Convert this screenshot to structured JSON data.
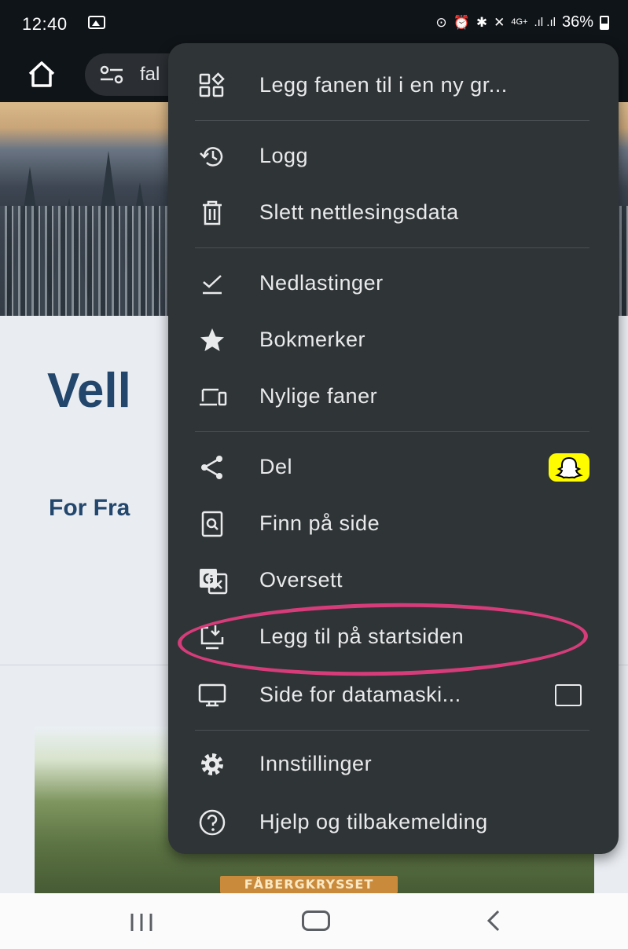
{
  "status_bar": {
    "time": "12:40",
    "network": "4G+",
    "signal": ".ıl .ıl",
    "battery": "36%"
  },
  "toolbar": {
    "url": "fal"
  },
  "page": {
    "title": "Vell",
    "subtitle": "For Fra",
    "photo_sign": "FÅBERGKRYSSET"
  },
  "menu": {
    "items": [
      {
        "label": "Legg fanen til i en ny gr...",
        "icon": "tab-group-icon"
      },
      {
        "label": "Logg",
        "icon": "history-icon"
      },
      {
        "label": "Slett nettlesingsdata",
        "icon": "trash-icon"
      },
      {
        "label": "Nedlastinger",
        "icon": "download-check-icon"
      },
      {
        "label": "Bokmerker",
        "icon": "star-icon"
      },
      {
        "label": "Nylige faner",
        "icon": "devices-icon"
      },
      {
        "label": "Del",
        "icon": "share-icon"
      },
      {
        "label": "Finn på side",
        "icon": "find-in-page-icon"
      },
      {
        "label": "Oversett",
        "icon": "translate-icon"
      },
      {
        "label": "Legg til på startsiden",
        "icon": "add-to-home-icon"
      },
      {
        "label": "Side for datamaski...",
        "icon": "desktop-icon"
      },
      {
        "label": "Innstillinger",
        "icon": "gear-icon"
      },
      {
        "label": "Hjelp og tilbakemelding",
        "icon": "help-icon"
      }
    ],
    "highlight_color": "#d63c7a",
    "snapchat_color": "#fffc00"
  }
}
